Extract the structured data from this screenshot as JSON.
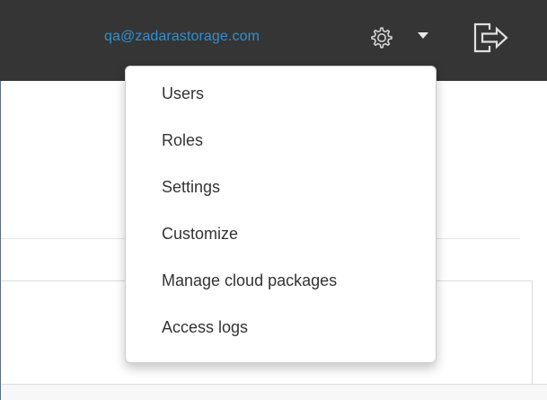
{
  "header": {
    "user_email": "qa@zadarastorage.com",
    "settings_icon": "gear-icon",
    "caret_icon": "caret-down-icon",
    "logout_icon": "logout-icon"
  },
  "menu": {
    "items": [
      {
        "label": "Users"
      },
      {
        "label": "Roles"
      },
      {
        "label": "Settings"
      },
      {
        "label": "Customize"
      },
      {
        "label": "Manage cloud packages"
      },
      {
        "label": "Access logs"
      }
    ]
  },
  "colors": {
    "topbar_bg": "#353535",
    "email_link": "#2c90d6",
    "menu_text": "#333333",
    "menu_bg": "#ffffff"
  }
}
